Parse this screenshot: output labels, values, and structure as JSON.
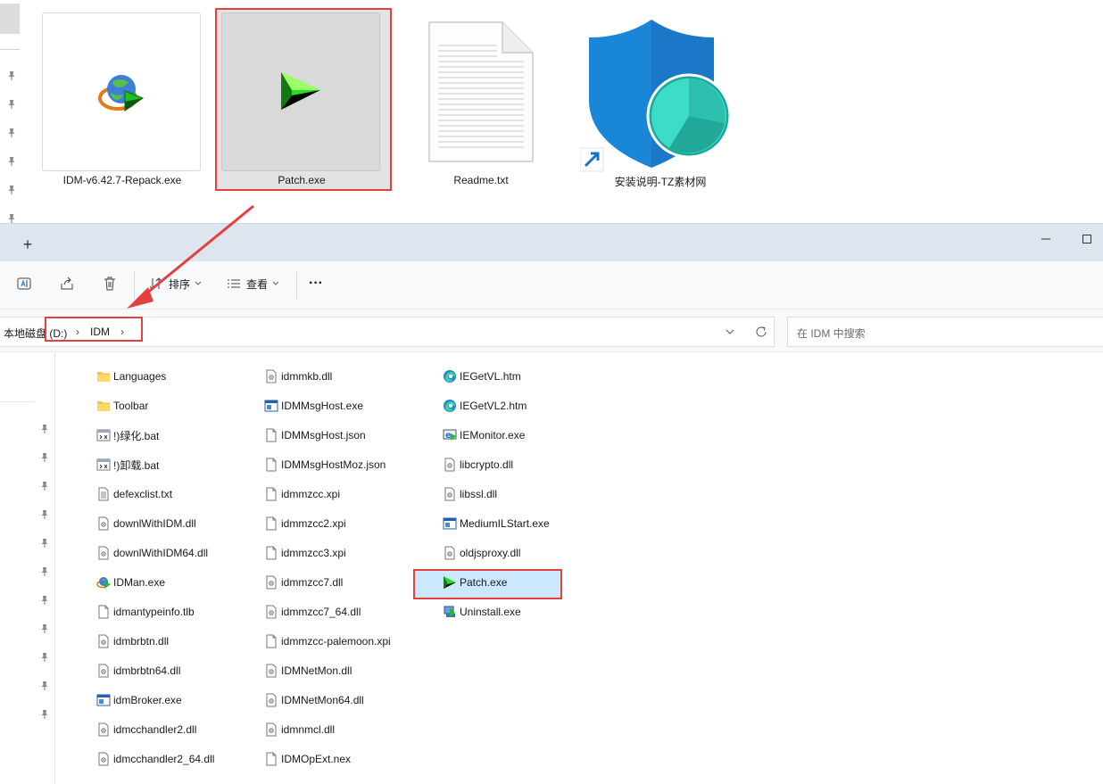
{
  "top_tiles": [
    {
      "label": "IDM-v6.42.7-Repack.exe",
      "icon": "idm-globe-icon"
    },
    {
      "label": "Patch.exe",
      "icon": "green-arrow-icon"
    },
    {
      "label": "Readme.txt",
      "icon": "text-document-icon"
    },
    {
      "label": "安装说明-TZ素材网",
      "icon": "shield-shortcut-icon"
    }
  ],
  "tabbar": {
    "add_label": "+"
  },
  "toolbar": {
    "sort_label": "排序",
    "view_label": "查看",
    "more_label": "···"
  },
  "address": {
    "drive_label": "本地磁盘 (D:)",
    "folder_label": "IDM",
    "chevron": "›"
  },
  "search": {
    "placeholder": "在 IDM 中搜索"
  },
  "files": {
    "col1": [
      {
        "name": "Languages",
        "icon": "folder-icon"
      },
      {
        "name": "Toolbar",
        "icon": "folder-icon"
      },
      {
        "name": "!)绿化.bat",
        "icon": "batch-file-icon"
      },
      {
        "name": "!)卸载.bat",
        "icon": "batch-file-icon"
      },
      {
        "name": "defexclist.txt",
        "icon": "text-file-icon"
      },
      {
        "name": "downlWithIDM.dll",
        "icon": "dll-file-icon"
      },
      {
        "name": "downlWithIDM64.dll",
        "icon": "dll-file-icon"
      },
      {
        "name": "IDMan.exe",
        "icon": "idm-globe-icon"
      },
      {
        "name": "idmantypeinfo.tlb",
        "icon": "blank-file-icon"
      },
      {
        "name": "idmbrbtn.dll",
        "icon": "dll-file-icon"
      },
      {
        "name": "idmbrbtn64.dll",
        "icon": "dll-file-icon"
      },
      {
        "name": "idmBroker.exe",
        "icon": "exe-window-icon"
      },
      {
        "name": "idmcchandler2.dll",
        "icon": "dll-file-icon"
      },
      {
        "name": "idmcchandler2_64.dll",
        "icon": "dll-file-icon"
      }
    ],
    "col2": [
      {
        "name": "idmmkb.dll",
        "icon": "dll-file-icon"
      },
      {
        "name": "IDMMsgHost.exe",
        "icon": "exe-window-icon"
      },
      {
        "name": "IDMMsgHost.json",
        "icon": "blank-file-icon"
      },
      {
        "name": "IDMMsgHostMoz.json",
        "icon": "blank-file-icon"
      },
      {
        "name": "idmmzcc.xpi",
        "icon": "blank-file-icon"
      },
      {
        "name": "idmmzcc2.xpi",
        "icon": "blank-file-icon"
      },
      {
        "name": "idmmzcc3.xpi",
        "icon": "blank-file-icon"
      },
      {
        "name": "idmmzcc7.dll",
        "icon": "dll-file-icon"
      },
      {
        "name": "idmmzcc7_64.dll",
        "icon": "dll-file-icon"
      },
      {
        "name": "idmmzcc-palemoon.xpi",
        "icon": "blank-file-icon"
      },
      {
        "name": "IDMNetMon.dll",
        "icon": "dll-file-icon"
      },
      {
        "name": "IDMNetMon64.dll",
        "icon": "dll-file-icon"
      },
      {
        "name": "idmnmcl.dll",
        "icon": "dll-file-icon"
      },
      {
        "name": "IDMOpExt.nex",
        "icon": "blank-file-icon"
      }
    ],
    "col3": [
      {
        "name": "IEGetVL.htm",
        "icon": "edge-icon"
      },
      {
        "name": "IEGetVL2.htm",
        "icon": "edge-icon"
      },
      {
        "name": "IEMonitor.exe",
        "icon": "ie-monitor-icon"
      },
      {
        "name": "libcrypto.dll",
        "icon": "dll-file-icon"
      },
      {
        "name": "libssl.dll",
        "icon": "dll-file-icon"
      },
      {
        "name": "MediumILStart.exe",
        "icon": "exe-window-icon"
      },
      {
        "name": "oldjsproxy.dll",
        "icon": "dll-file-icon"
      },
      {
        "name": "Patch.exe",
        "icon": "green-arrow-icon"
      },
      {
        "name": "Uninstall.exe",
        "icon": "uninstall-icon"
      }
    ]
  },
  "colors": {
    "highlight": "#e3403f",
    "selection": "#cce8ff",
    "tabbar": "#dde5ee"
  }
}
